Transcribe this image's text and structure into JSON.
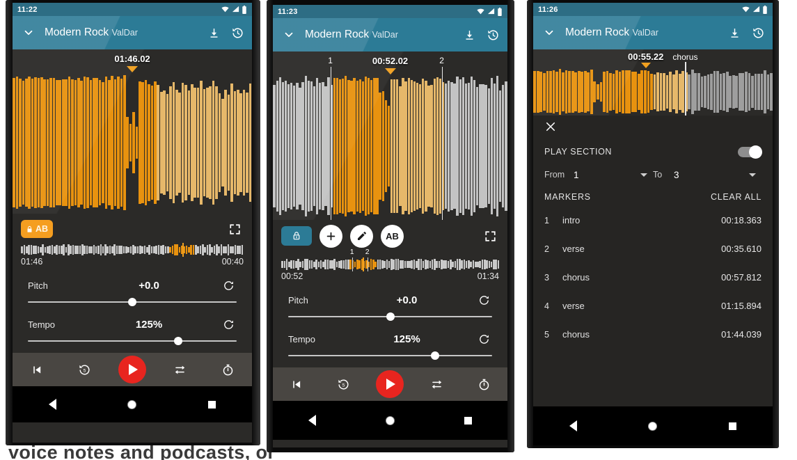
{
  "background": {
    "text": "voice notes and podcasts, or"
  },
  "colors": {
    "accent_orange": "#f0a020",
    "appbar_teal": "#2c7b96",
    "statusbar_teal": "#2d6d84",
    "play_red": "#e8251f",
    "panel_dark": "#2b2a28",
    "sheet_dark": "#262523",
    "transport_gray": "#494642",
    "wave_gray": "#c9c9c9"
  },
  "phones": [
    {
      "id": "phone-1",
      "status": {
        "time": "11:22",
        "icons": [
          "wifi-icon",
          "signal-icon",
          "battery-icon"
        ]
      },
      "appbar": {
        "collapse_icon": "chevron-down-icon",
        "title": "Modern Rock",
        "subtitle": "ValDar",
        "actions": [
          "download-icon",
          "history-icon"
        ]
      },
      "waveform": {
        "playhead_label": "01:46.02",
        "playhead_pct": 50,
        "markers": []
      },
      "tools": {
        "ab_chip": {
          "icon": "lock-icon",
          "label": "AB",
          "active": true
        },
        "expand_icon": "fullscreen-icon"
      },
      "minimap": {
        "left_time": "01:46",
        "right_time": "00:40",
        "playhead_pct": 72.5,
        "highlight_start_pct": 66,
        "highlight_end_pct": 78,
        "markers": []
      },
      "sliders": [
        {
          "name": "Pitch",
          "value": "+0.0",
          "knob_pct": 50,
          "reset_icon": "reset-icon"
        },
        {
          "name": "Tempo",
          "value": "125%",
          "knob_pct": 72,
          "reset_icon": "reset-icon"
        }
      ],
      "transport": [
        "skip-previous-icon",
        "rewind-5-icon",
        "play-icon",
        "loop-icon",
        "timer-icon"
      ],
      "nav": [
        "back-icon",
        "home-icon",
        "recents-icon"
      ]
    },
    {
      "id": "phone-2",
      "status": {
        "time": "11:23",
        "icons": [
          "wifi-icon",
          "signal-icon",
          "battery-icon"
        ]
      },
      "appbar": {
        "collapse_icon": "chevron-down-icon",
        "title": "Modern Rock",
        "subtitle": "ValDar",
        "actions": [
          "download-icon",
          "history-icon"
        ]
      },
      "waveform": {
        "playhead_label": "00:52.02",
        "playhead_pct": 50,
        "markers": [
          {
            "label": "1",
            "pct": 24.5
          },
          {
            "label": "2",
            "pct": 72.0
          }
        ]
      },
      "tools": {
        "lock_button": {
          "icon": "lock-icon",
          "active": true
        },
        "add_button": {
          "icon": "plus-icon",
          "label": ""
        },
        "edit_button": {
          "icon": "pencil-icon",
          "label": ""
        },
        "ab_button": {
          "icon": "ab-icon",
          "label": "AB"
        },
        "expand_icon": "fullscreen-icon"
      },
      "minimap": {
        "left_time": "00:52",
        "right_time": "01:34",
        "playhead_pct": 37.5,
        "highlight_start_pct": 31,
        "highlight_end_pct": 43,
        "markers": [
          {
            "label": "1",
            "pct": 32.5
          },
          {
            "label": "2",
            "pct": 39.5
          }
        ]
      },
      "sliders": [
        {
          "name": "Pitch",
          "value": "+0.0",
          "knob_pct": 50,
          "reset_icon": "reset-icon"
        },
        {
          "name": "Tempo",
          "value": "125%",
          "knob_pct": 72,
          "reset_icon": "reset-icon"
        }
      ],
      "transport": [
        "skip-previous-icon",
        "rewind-5-icon",
        "play-icon",
        "loop-icon",
        "timer-icon"
      ],
      "nav": [
        "back-icon",
        "home-icon",
        "recents-icon"
      ]
    },
    {
      "id": "phone-3",
      "status": {
        "time": "11:26",
        "icons": [
          "wifi-icon",
          "signal-icon",
          "battery-icon"
        ]
      },
      "appbar": {
        "collapse_icon": "chevron-down-icon",
        "title": "Modern Rock",
        "subtitle": "ValDar",
        "actions": [
          "download-icon",
          "history-icon"
        ]
      },
      "waveform": {
        "playhead_label": "00:55.22",
        "playhead_pct": 47,
        "markers": [
          {
            "label": "chorus",
            "pct": 63.5
          }
        ]
      },
      "sheet": {
        "close_icon": "close-icon",
        "play_section_label": "PLAY SECTION",
        "play_section_on": true,
        "from_label": "From",
        "from_value": "1",
        "to_label": "To",
        "to_value": "3",
        "markers_label": "MARKERS",
        "clear_all_label": "CLEAR ALL",
        "markers": [
          {
            "index": "1",
            "name": "intro",
            "time": "00:18.363"
          },
          {
            "index": "2",
            "name": "verse",
            "time": "00:35.610"
          },
          {
            "index": "3",
            "name": "chorus",
            "time": "00:57.812"
          },
          {
            "index": "4",
            "name": "verse",
            "time": "01:15.894"
          },
          {
            "index": "5",
            "name": "chorus",
            "time": "01:44.039"
          }
        ]
      },
      "nav": [
        "back-icon",
        "home-icon",
        "recents-icon"
      ]
    }
  ]
}
